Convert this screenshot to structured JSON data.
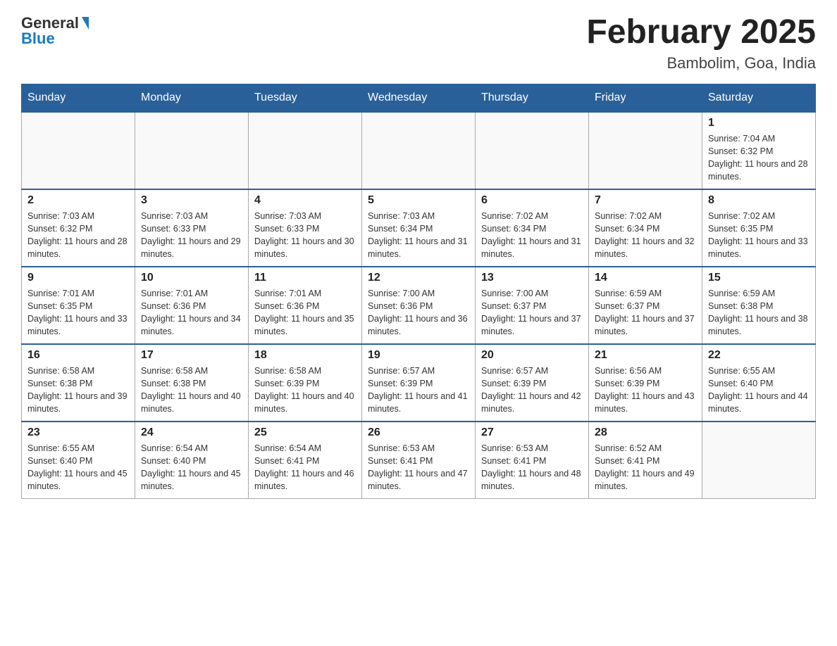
{
  "header": {
    "logo_general": "General",
    "logo_blue": "Blue",
    "month_title": "February 2025",
    "location": "Bambolim, Goa, India"
  },
  "days_of_week": [
    "Sunday",
    "Monday",
    "Tuesday",
    "Wednesday",
    "Thursday",
    "Friday",
    "Saturday"
  ],
  "weeks": [
    [
      {
        "day": "",
        "info": ""
      },
      {
        "day": "",
        "info": ""
      },
      {
        "day": "",
        "info": ""
      },
      {
        "day": "",
        "info": ""
      },
      {
        "day": "",
        "info": ""
      },
      {
        "day": "",
        "info": ""
      },
      {
        "day": "1",
        "info": "Sunrise: 7:04 AM\nSunset: 6:32 PM\nDaylight: 11 hours and 28 minutes."
      }
    ],
    [
      {
        "day": "2",
        "info": "Sunrise: 7:03 AM\nSunset: 6:32 PM\nDaylight: 11 hours and 28 minutes."
      },
      {
        "day": "3",
        "info": "Sunrise: 7:03 AM\nSunset: 6:33 PM\nDaylight: 11 hours and 29 minutes."
      },
      {
        "day": "4",
        "info": "Sunrise: 7:03 AM\nSunset: 6:33 PM\nDaylight: 11 hours and 30 minutes."
      },
      {
        "day": "5",
        "info": "Sunrise: 7:03 AM\nSunset: 6:34 PM\nDaylight: 11 hours and 31 minutes."
      },
      {
        "day": "6",
        "info": "Sunrise: 7:02 AM\nSunset: 6:34 PM\nDaylight: 11 hours and 31 minutes."
      },
      {
        "day": "7",
        "info": "Sunrise: 7:02 AM\nSunset: 6:34 PM\nDaylight: 11 hours and 32 minutes."
      },
      {
        "day": "8",
        "info": "Sunrise: 7:02 AM\nSunset: 6:35 PM\nDaylight: 11 hours and 33 minutes."
      }
    ],
    [
      {
        "day": "9",
        "info": "Sunrise: 7:01 AM\nSunset: 6:35 PM\nDaylight: 11 hours and 33 minutes."
      },
      {
        "day": "10",
        "info": "Sunrise: 7:01 AM\nSunset: 6:36 PM\nDaylight: 11 hours and 34 minutes."
      },
      {
        "day": "11",
        "info": "Sunrise: 7:01 AM\nSunset: 6:36 PM\nDaylight: 11 hours and 35 minutes."
      },
      {
        "day": "12",
        "info": "Sunrise: 7:00 AM\nSunset: 6:36 PM\nDaylight: 11 hours and 36 minutes."
      },
      {
        "day": "13",
        "info": "Sunrise: 7:00 AM\nSunset: 6:37 PM\nDaylight: 11 hours and 37 minutes."
      },
      {
        "day": "14",
        "info": "Sunrise: 6:59 AM\nSunset: 6:37 PM\nDaylight: 11 hours and 37 minutes."
      },
      {
        "day": "15",
        "info": "Sunrise: 6:59 AM\nSunset: 6:38 PM\nDaylight: 11 hours and 38 minutes."
      }
    ],
    [
      {
        "day": "16",
        "info": "Sunrise: 6:58 AM\nSunset: 6:38 PM\nDaylight: 11 hours and 39 minutes."
      },
      {
        "day": "17",
        "info": "Sunrise: 6:58 AM\nSunset: 6:38 PM\nDaylight: 11 hours and 40 minutes."
      },
      {
        "day": "18",
        "info": "Sunrise: 6:58 AM\nSunset: 6:39 PM\nDaylight: 11 hours and 40 minutes."
      },
      {
        "day": "19",
        "info": "Sunrise: 6:57 AM\nSunset: 6:39 PM\nDaylight: 11 hours and 41 minutes."
      },
      {
        "day": "20",
        "info": "Sunrise: 6:57 AM\nSunset: 6:39 PM\nDaylight: 11 hours and 42 minutes."
      },
      {
        "day": "21",
        "info": "Sunrise: 6:56 AM\nSunset: 6:39 PM\nDaylight: 11 hours and 43 minutes."
      },
      {
        "day": "22",
        "info": "Sunrise: 6:55 AM\nSunset: 6:40 PM\nDaylight: 11 hours and 44 minutes."
      }
    ],
    [
      {
        "day": "23",
        "info": "Sunrise: 6:55 AM\nSunset: 6:40 PM\nDaylight: 11 hours and 45 minutes."
      },
      {
        "day": "24",
        "info": "Sunrise: 6:54 AM\nSunset: 6:40 PM\nDaylight: 11 hours and 45 minutes."
      },
      {
        "day": "25",
        "info": "Sunrise: 6:54 AM\nSunset: 6:41 PM\nDaylight: 11 hours and 46 minutes."
      },
      {
        "day": "26",
        "info": "Sunrise: 6:53 AM\nSunset: 6:41 PM\nDaylight: 11 hours and 47 minutes."
      },
      {
        "day": "27",
        "info": "Sunrise: 6:53 AM\nSunset: 6:41 PM\nDaylight: 11 hours and 48 minutes."
      },
      {
        "day": "28",
        "info": "Sunrise: 6:52 AM\nSunset: 6:41 PM\nDaylight: 11 hours and 49 minutes."
      },
      {
        "day": "",
        "info": ""
      }
    ]
  ]
}
